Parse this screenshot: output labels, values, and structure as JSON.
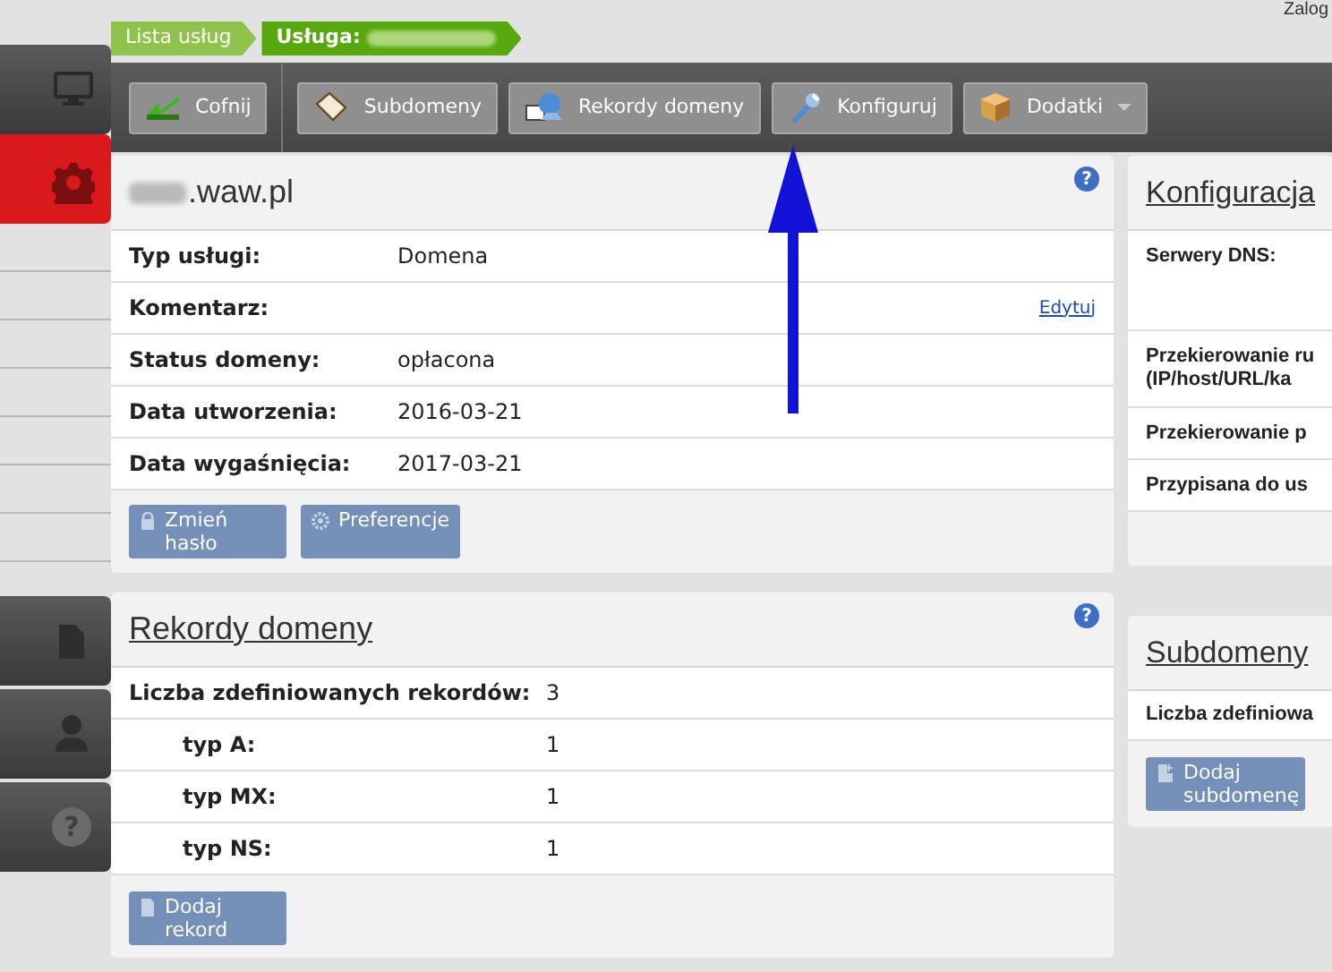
{
  "header": {
    "login_text": "Zalog"
  },
  "sidebar": {
    "items": [
      {
        "selected": false
      },
      {
        "selected": true
      }
    ],
    "help_glyph": "?"
  },
  "breadcrumb": [
    {
      "label": "Lista usług",
      "selected": false,
      "redacted": false
    },
    {
      "label": "Usługa:",
      "selected": true,
      "redacted": true
    }
  ],
  "toolbar": {
    "buttons": [
      {
        "label": "Cofnij",
        "dropdown": false
      },
      {
        "label": "Subdomeny",
        "dropdown": false
      },
      {
        "label": "Rekordy domeny",
        "dropdown": false
      },
      {
        "label": "Konfiguruj",
        "dropdown": false
      },
      {
        "label": "Dodatki",
        "dropdown": true
      }
    ]
  },
  "service_panel": {
    "title": ".waw.pl",
    "title_redacted": true,
    "help": "?",
    "rows": [
      {
        "label": "Typ usługi:",
        "value": "Domena"
      },
      {
        "label": "Komentarz:",
        "value": "",
        "link": "Edytuj"
      },
      {
        "label": "Status domeny:",
        "value": "opłacona"
      },
      {
        "label": "Data utworzenia:",
        "value": "2016-03-21"
      },
      {
        "label": "Data wygaśnięcia:",
        "value": "2017-03-21"
      }
    ],
    "buttons": [
      "Zmień hasło",
      "Preferencje"
    ]
  },
  "records_panel": {
    "title": "Rekordy domeny",
    "help": "?",
    "rows": [
      {
        "label": "Liczba zdefiniowanych rekordów:",
        "value": "3",
        "indented": false
      },
      {
        "label": "typ A:",
        "value": "1",
        "indented": true
      },
      {
        "label": "typ MX:",
        "value": "1",
        "indented": true
      },
      {
        "label": "typ NS:",
        "value": "1",
        "indented": true
      }
    ],
    "buttons": [
      "Dodaj rekord"
    ]
  },
  "config_panel": {
    "title": "Konfiguracja",
    "rows": [
      {
        "lines": [
          "Serwery DNS:"
        ],
        "kind": "tall"
      },
      {
        "lines": [
          "Przekierowanie ru",
          "(IP/host/URL/ka"
        ],
        "kind": "normal"
      },
      {
        "lines": [
          "Przekierowanie p"
        ],
        "kind": "normal"
      },
      {
        "lines": [
          "Przypisana do us"
        ],
        "kind": "normal"
      }
    ]
  },
  "subdomains_panel": {
    "title": "Subdomeny",
    "rows": [
      "Liczba zdefiniowa"
    ],
    "buttons": [
      "Dodaj subdomenę"
    ]
  }
}
